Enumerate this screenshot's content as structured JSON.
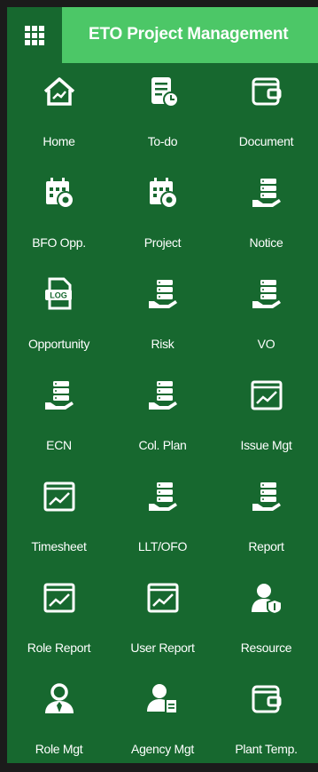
{
  "header": {
    "title": "ETO Project Management",
    "menu_icon": "grid-menu-icon"
  },
  "tiles": [
    {
      "label": "Home",
      "icon": "home-chart-icon"
    },
    {
      "label": "To-do",
      "icon": "todo-clock-icon"
    },
    {
      "label": "Document",
      "icon": "wallet-icon"
    },
    {
      "label": "BFO Opp.",
      "icon": "calendar-gear-icon"
    },
    {
      "label": "Project",
      "icon": "calendar-gear-icon"
    },
    {
      "label": "Notice",
      "icon": "server-hand-icon"
    },
    {
      "label": "Opportunity",
      "icon": "log-file-icon"
    },
    {
      "label": "Risk",
      "icon": "server-hand-icon"
    },
    {
      "label": "VO",
      "icon": "server-hand-icon"
    },
    {
      "label": "ECN",
      "icon": "server-hand-icon"
    },
    {
      "label": "Col. Plan",
      "icon": "server-hand-icon"
    },
    {
      "label": "Issue Mgt",
      "icon": "chart-window-icon"
    },
    {
      "label": "Timesheet",
      "icon": "chart-window-icon"
    },
    {
      "label": "LLT/OFO",
      "icon": "server-hand-icon"
    },
    {
      "label": "Report",
      "icon": "server-hand-icon"
    },
    {
      "label": "Role Report",
      "icon": "chart-window-icon"
    },
    {
      "label": "User Report",
      "icon": "chart-window-icon"
    },
    {
      "label": "Resource",
      "icon": "user-shield-icon"
    },
    {
      "label": "Role Mgt",
      "icon": "user-tie-icon"
    },
    {
      "label": "Agency Mgt",
      "icon": "user-doc-icon"
    },
    {
      "label": "Plant Temp.",
      "icon": "wallet-icon"
    }
  ],
  "colors": {
    "panel": "#17682f",
    "title_bar": "#4cc767",
    "background": "#1b1b1b",
    "text": "#ffffff"
  }
}
